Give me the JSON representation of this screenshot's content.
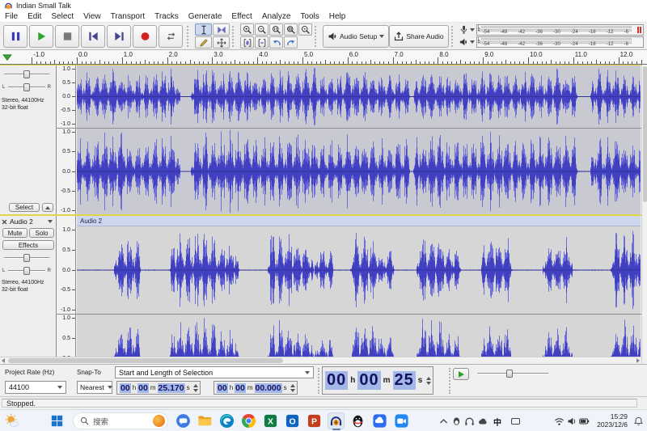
{
  "window": {
    "title": "Indian Small Talk"
  },
  "menu": {
    "items": [
      "File",
      "Edit",
      "Select",
      "View",
      "Transport",
      "Tracks",
      "Generate",
      "Effect",
      "Analyze",
      "Tools",
      "Help"
    ]
  },
  "toolbar": {
    "audio_setup_label": "Audio Setup",
    "share_audio_label": "Share Audio",
    "meters": {
      "scale": [
        "-54",
        "-48",
        "-42",
        "-36",
        "-30",
        "-24",
        "-18",
        "-12",
        "-6"
      ],
      "channels": [
        "L",
        "R"
      ]
    }
  },
  "ruler": {
    "pre_label": "-1.0",
    "labels": [
      "0.0",
      "1.0",
      "2.0",
      "3.0",
      "4.0",
      "5.0",
      "6.0",
      "7.0",
      "8.0",
      "9.0",
      "10.0",
      "11.0",
      "12.0"
    ]
  },
  "track_controls": {
    "pan_left": "L",
    "pan_right": "R"
  },
  "tracks": [
    {
      "info_line1": "Stereo, 44100Hz",
      "info_line2": "32-bit float",
      "select_label": "Select",
      "selected": true,
      "scale": [
        "1.0",
        "0.5",
        "0.0",
        "-0.5",
        "-1.0"
      ],
      "bursts": [
        [
          0.02,
          0.38,
          0.75
        ],
        [
          0.44,
          1.12,
          0.9
        ],
        [
          1.18,
          1.62,
          0.7
        ],
        [
          1.66,
          2.22,
          0.85
        ],
        [
          2.58,
          3.2,
          0.9
        ],
        [
          3.24,
          3.9,
          0.95
        ],
        [
          3.94,
          4.62,
          0.8
        ],
        [
          4.66,
          5.3,
          0.9
        ],
        [
          5.34,
          5.9,
          0.7
        ],
        [
          5.94,
          6.6,
          0.9
        ],
        [
          6.64,
          7.32,
          0.8
        ],
        [
          7.52,
          8.2,
          0.9
        ],
        [
          8.24,
          8.9,
          0.75
        ],
        [
          8.94,
          9.6,
          0.9
        ],
        [
          9.64,
          10.3,
          0.8
        ],
        [
          10.34,
          11.02,
          0.85
        ],
        [
          11.44,
          12.1,
          0.85
        ],
        [
          12.14,
          12.55,
          0.7
        ]
      ]
    },
    {
      "name": "Audio 2",
      "clip_title": "Audio 2",
      "mute_label": "Mute",
      "solo_label": "Solo",
      "effects_label": "Effects",
      "info_line1": "Stereo, 44100Hz",
      "info_line2": "32-bit float",
      "selected": false,
      "scale": [
        "1.0",
        "0.5",
        "0.0",
        "-0.5",
        "-1.0"
      ],
      "bursts": [
        [
          0.88,
          1.34,
          0.85
        ],
        [
          2.12,
          2.58,
          0.8
        ],
        [
          2.62,
          3.04,
          0.9
        ],
        [
          3.08,
          3.52,
          0.65
        ],
        [
          4.28,
          4.82,
          0.85
        ],
        [
          4.86,
          5.18,
          0.6
        ],
        [
          5.32,
          5.62,
          0.5
        ],
        [
          6.12,
          6.68,
          0.85
        ],
        [
          6.72,
          6.98,
          0.5
        ],
        [
          7.58,
          8.14,
          0.9
        ],
        [
          8.18,
          8.44,
          0.55
        ],
        [
          9.02,
          9.58,
          0.8
        ],
        [
          10.38,
          10.92,
          0.75
        ],
        [
          11.88,
          12.55,
          0.85
        ]
      ]
    }
  ],
  "selection_toolbar": {
    "project_rate_label": "Project Rate (Hz)",
    "project_rate_value": "44100",
    "snap_label": "Snap-To",
    "snap_value": "Nearest",
    "selection_mode": "Start and Length of Selection",
    "selection_start": {
      "h": "00",
      "m": "00",
      "s": "25.170"
    },
    "selection_length": {
      "h": "00",
      "m": "00",
      "s": "00.000"
    },
    "position": {
      "h": "00",
      "m": "00",
      "s": "25"
    },
    "units": {
      "h": "h",
      "m": "m",
      "s": "s"
    }
  },
  "status_bar": {
    "text": "Stopped."
  },
  "taskbar": {
    "search_text": "搜索",
    "ime_indicator": "中",
    "clock_time": "15:29",
    "clock_date": "2023/12/6",
    "glyphs": {
      "excel": "X",
      "outlook": "O",
      "powerpoint": "P"
    },
    "app_icons": [
      "chat",
      "file-explorer",
      "edge",
      "chrome",
      "excel",
      "outlook",
      "powerpoint",
      "audacity",
      "qq",
      "cloud-drive",
      "video-meeting"
    ]
  },
  "colors": {
    "waveform_outer": "#6f6fd8",
    "waveform_inner": "#4040c0",
    "waveform_center_line": "#32329a",
    "track_bg_selected": "#c9c9d2",
    "track_bg": "#d6d6d6",
    "selected_track_border": "#e4d44a",
    "play_green": "#2aa52a",
    "record_red": "#d42222",
    "time_digit_bg": "#a3b7e8",
    "time_digit_fg": "#14145e"
  }
}
